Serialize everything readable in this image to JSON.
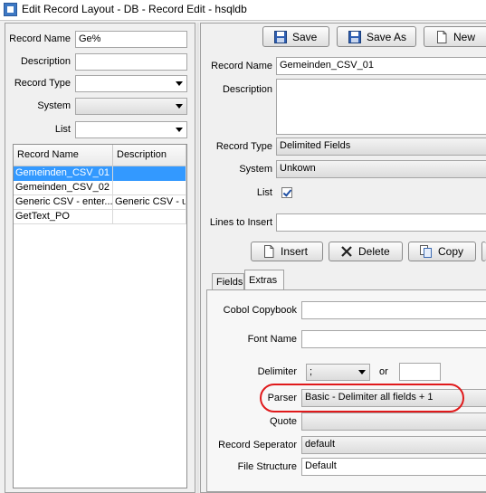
{
  "window": {
    "title": "Edit Record Layout - DB - Record Edit - hsqldb"
  },
  "search": {
    "record_name_label": "Record Name",
    "record_name_value": "Ge%",
    "description_label": "Description",
    "description_value": "",
    "record_type_label": "Record Type",
    "system_label": "System",
    "list_label": "List"
  },
  "results": {
    "columns": [
      "Record Name",
      "Description"
    ],
    "rows": [
      {
        "name": "Gemeinden_CSV_01",
        "description": ""
      },
      {
        "name": "Gemeinden_CSV_02",
        "description": ""
      },
      {
        "name": "Generic CSV - enter...",
        "description": "Generic CSV - use"
      },
      {
        "name": "GetText_PO",
        "description": ""
      }
    ]
  },
  "toolbar": {
    "save": "Save",
    "save_as": "Save As",
    "new": "New"
  },
  "record": {
    "record_name_label": "Record Name",
    "record_name_value": "Gemeinden_CSV_01",
    "description_label": "Description",
    "description_value": "",
    "record_type_label": "Record Type",
    "record_type_value": "Delimited Fields",
    "system_label": "System",
    "system_value": "Unkown",
    "list_label": "List",
    "lines_to_insert_label": "Lines to Insert",
    "lines_to_insert_value": ""
  },
  "actions": {
    "insert": "Insert",
    "delete": "Delete",
    "copy": "Copy"
  },
  "tabs": [
    "Fields",
    "Extras"
  ],
  "extras": {
    "cobol_copybook_label": "Cobol Copybook",
    "cobol_copybook_value": "",
    "font_name_label": "Font Name",
    "font_name_value": "",
    "delimiter_label": "Delimiter",
    "delimiter_value": ";",
    "or_label": "or",
    "delimiter_other_value": "",
    "parser_label": "Parser",
    "parser_value": "Basic - Delimiter all fields + 1",
    "quote_label": "Quote",
    "quote_value": "",
    "record_separator_label": "Record Seperator",
    "record_separator_value": "default",
    "file_structure_label": "File Structure",
    "file_structure_value": "Default"
  },
  "colors": {
    "selection": "#3399ff",
    "highlight": "#e0191b"
  }
}
